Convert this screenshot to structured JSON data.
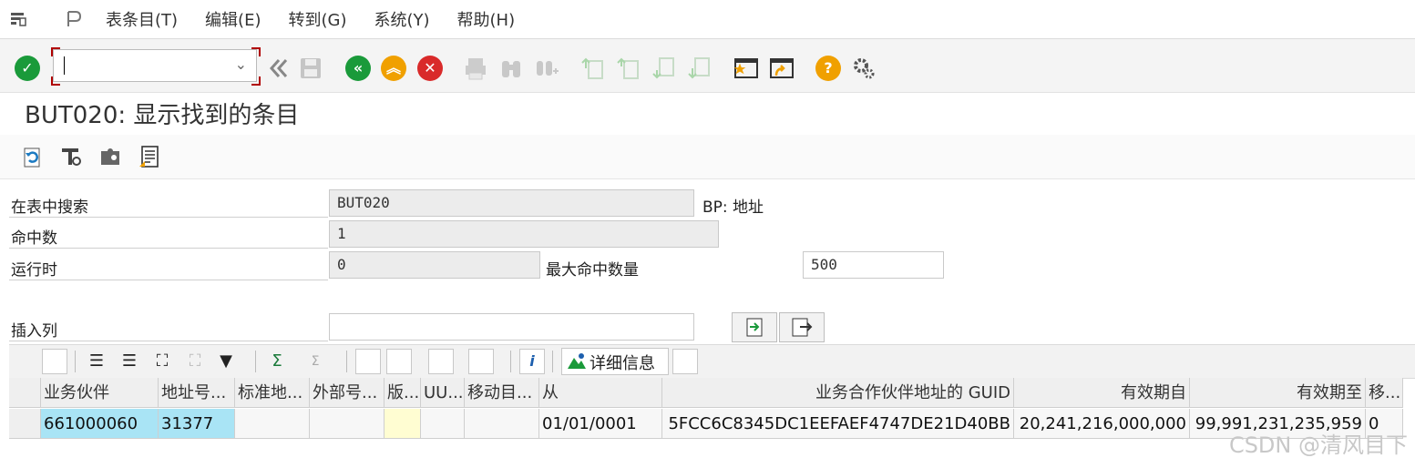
{
  "menu": {
    "items": [
      "表条目(T)",
      "编辑(E)",
      "转到(G)",
      "系统(Y)",
      "帮助(H)"
    ]
  },
  "title": "BUT020: 显示找到的条目",
  "form": {
    "search_label": "在表中搜索",
    "search_value": "BUT020",
    "table_desc": "BP: 地址",
    "hits_label": "命中数",
    "hits_value": "1",
    "runtime_label": "运行时",
    "runtime_value": "0",
    "max_hits_label": "最大命中数量",
    "max_hits_value": "500",
    "insert_col_label": "插入列",
    "insert_col_value": ""
  },
  "alv": {
    "details_label": "详细信息",
    "columns": [
      "业务伙伴",
      "地址号...",
      "标准地...",
      "外部号...",
      "版...",
      "UU...",
      "移动目...",
      "从",
      "业务合作伙伴地址的 GUID",
      "有效期自",
      "有效期至",
      "移..."
    ],
    "rows": [
      [
        "661000060",
        "31377",
        "",
        "",
        "",
        "",
        "",
        "01/01/0001",
        "5FCC6C8345DC1EEFAEF4747DE21D40BB",
        "20,241,216,000,000",
        "99,991,231,235,959",
        "0"
      ]
    ]
  },
  "watermark": "CSDN @清风目下",
  "colors": {
    "accent_green": "#1a9a3a",
    "accent_orange": "#f0a000",
    "accent_red": "#d92a2a",
    "selected_cell": "#a9e4f5",
    "yellow_cell": "#fffdd2"
  }
}
